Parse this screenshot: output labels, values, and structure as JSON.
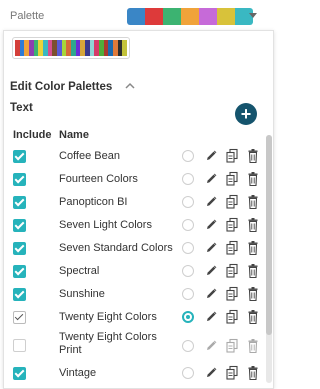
{
  "header": {
    "label": "Palette",
    "selected_swatches": [
      "#3a86c6",
      "#dd3a3a",
      "#3cb371",
      "#f0a33a",
      "#c66ad8",
      "#d8c23a",
      "#3ab8c2"
    ]
  },
  "panel": {
    "preview_swatches": [
      "#d43f3a",
      "#2e7bd6",
      "#f0a33a",
      "#8e3fb0",
      "#3cb371",
      "#e8d33a",
      "#3ab8c2",
      "#d64f8e",
      "#7c4f2e",
      "#5a5ad6",
      "#a6d63a",
      "#d66a3a",
      "#2ea88e",
      "#6a2ed6",
      "#d6a63a",
      "#3a3a8e",
      "#8ed6d6",
      "#d63a6a",
      "#4fae3a",
      "#aa3a2e",
      "#1b6ab0",
      "#e07a3a",
      "#2e2e2e",
      "#c2c23a"
    ],
    "section_title": "Edit Color Palettes",
    "text_label": "Text",
    "columns": {
      "include": "Include",
      "name": "Name"
    }
  },
  "palettes": [
    {
      "name": "Coffee Bean",
      "include": "on",
      "selected": false,
      "editable": true
    },
    {
      "name": "Fourteen Colors",
      "include": "on",
      "selected": false,
      "editable": true
    },
    {
      "name": "Panopticon BI",
      "include": "on",
      "selected": false,
      "editable": true
    },
    {
      "name": "Seven Light Colors",
      "include": "on",
      "selected": false,
      "editable": true
    },
    {
      "name": "Seven Standard Colors",
      "include": "on",
      "selected": false,
      "editable": true
    },
    {
      "name": "Spectral",
      "include": "on",
      "selected": false,
      "editable": true
    },
    {
      "name": "Sunshine",
      "include": "on",
      "selected": false,
      "editable": true
    },
    {
      "name": "Twenty Eight Colors",
      "include": "plain",
      "selected": true,
      "editable": true
    },
    {
      "name": "Twenty Eight Colors Print",
      "include": "off",
      "selected": false,
      "editable": false
    },
    {
      "name": "Vintage",
      "include": "on",
      "selected": false,
      "editable": true
    }
  ],
  "colors": {
    "accent": "#26b3bb",
    "add_button": "#15546d"
  }
}
